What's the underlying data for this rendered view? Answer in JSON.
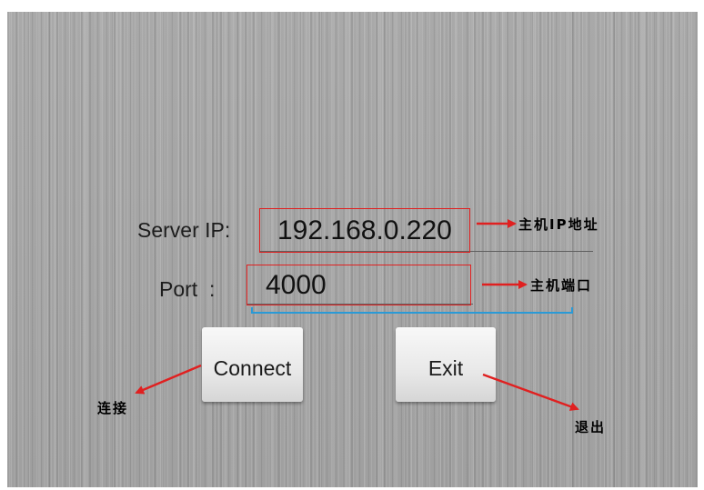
{
  "form": {
    "server_ip_label": "Server IP:",
    "server_ip_value": "192.168.0.220",
    "port_label": "Port  :",
    "port_value": "4000"
  },
  "buttons": {
    "connect_label": "Connect",
    "exit_label": "Exit"
  },
  "annotations": {
    "server_ip_note": "主机IP地址",
    "port_note": "主机端口",
    "connect_note": "连接",
    "exit_note": "退出"
  },
  "colors": {
    "annotation_box": "#e02020",
    "annotation_arrow": "#e02020",
    "bracket": "#2a9ad6"
  }
}
